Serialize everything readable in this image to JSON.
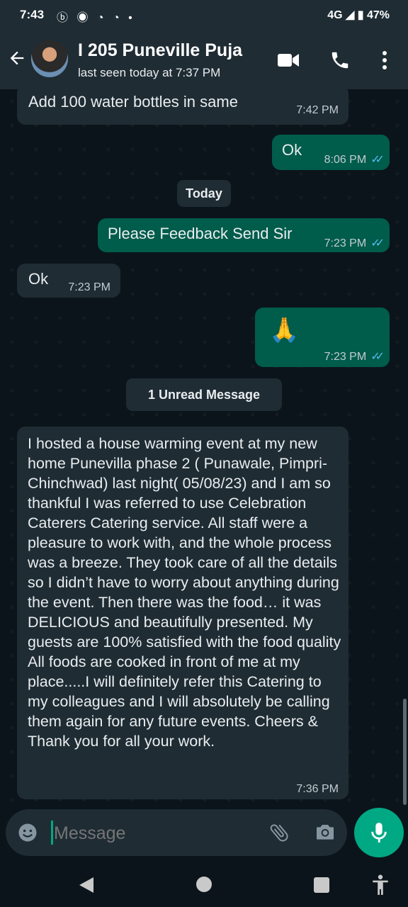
{
  "status_bar": {
    "time": "7:43",
    "notification_icons": "ⓑ ◉ ◔ ◔ •",
    "right": "4G ◢ ▮ 47%"
  },
  "header": {
    "contact_name": "I 205 Puneville Puja",
    "last_seen": "last seen today at 7:37 PM"
  },
  "messages": [
    {
      "text": "Add 100 water bottles in same",
      "time": "7:42 PM",
      "direction": "in"
    },
    {
      "text": "Ok",
      "time": "8:06 PM",
      "direction": "out",
      "ticks": "✓✓"
    },
    {
      "text": "Please Feedback Send Sir",
      "time": "7:23 PM",
      "direction": "out",
      "ticks": "✓✓"
    },
    {
      "text": "Ok",
      "time": "7:23 PM",
      "direction": "in"
    },
    {
      "text": "🙏",
      "time": "7:23 PM",
      "direction": "out",
      "ticks": "✓✓"
    },
    {
      "text": "I hosted a house warming event at my new home Punevilla phase 2 ( Punawale, Pimpri-Chinchwad) last night( 05/08/23) and I am so thankful I was referred to use Celebration Caterers Catering service. All staff were a pleasure to work with, and the whole process was a breeze. They took care of all the details so I didn’t have to worry about anything during the event. Then there was the food… it was DELICIOUS and beautifully presented. My guests are 100% satisfied with the food quality All foods are cooked in front of me at my place.....I will definitely refer this Catering to my colleagues and I will absolutely be calling them again for any future events. Cheers & Thank you for all your work.",
      "time": "7:36 PM",
      "direction": "in"
    }
  ],
  "day_chip": "Today",
  "unread_banner": "1 Unread Message",
  "composer": {
    "placeholder": "Message"
  },
  "colors": {
    "incoming": "#1f2c34",
    "outgoing": "#005c4b",
    "accent": "#00a884",
    "read_tick": "#53bdeb"
  }
}
